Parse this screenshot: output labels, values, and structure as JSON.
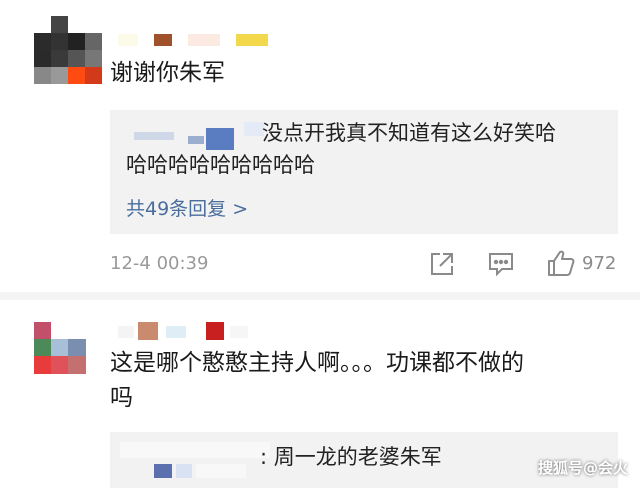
{
  "comments": [
    {
      "text": "谢谢你朱军",
      "reply_preview_line1": "没点开我真不知道有这么好笑哈",
      "reply_preview_line2": "哈哈哈哈哈哈哈哈哈",
      "reply_count": "共49条回复 >",
      "time": "12-4 00:39",
      "likes": "972",
      "icons": [
        "share-icon",
        "comment-icon",
        "like-icon"
      ]
    },
    {
      "text_line1": "这是哪个憨憨主持人啊。。。功课都不做的",
      "text_line2": "吗",
      "reply_preview": ": 周一龙的老婆朱军"
    }
  ],
  "watermark": "搜狐号@会火",
  "colors": {
    "reply_count": "#4a6d9c",
    "meta": "#9a9a9a",
    "reply_bg": "#f2f2f2"
  }
}
